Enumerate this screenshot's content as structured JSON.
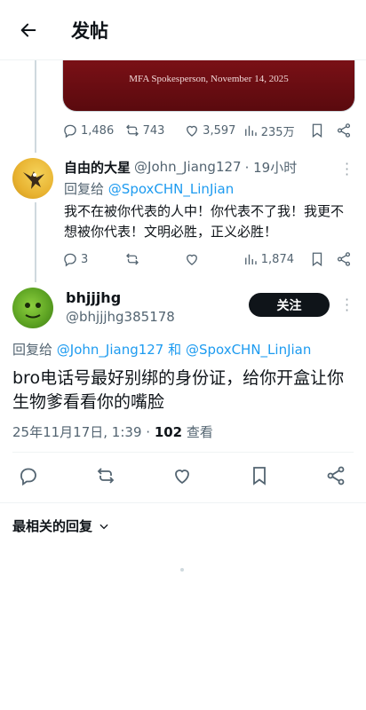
{
  "header": {
    "title": "发帖"
  },
  "quoted_post": {
    "caption": "MFA Spokesperson, November 14, 2025",
    "stats": {
      "replies": "1,486",
      "reposts": "743",
      "likes": "3,597",
      "views": "235万"
    }
  },
  "reply1": {
    "display_name": "自由的大星",
    "handle": "@John_Jiang127",
    "time": "· 19小时",
    "reply_prefix": "回复给",
    "reply_to": "@SpoxCHN_LinJian",
    "text": "我不在被你代表的人中！你代表不了我！我更不想被你代表！文明必胜，正义必胜！",
    "stats": {
      "replies": "3",
      "reposts": "",
      "likes": "",
      "views": "1,874"
    }
  },
  "main_post": {
    "display_name": "bhjjjhg",
    "handle": "@bhjjjhg385178",
    "follow_label": "关注",
    "reply_prefix": "回复给",
    "reply_to_1": "@John_Jiang127",
    "reply_conj": "和",
    "reply_to_2": "@SpoxCHN_LinJian",
    "text": "bro电话号最好别绑的身份证，给你开盒让你生物爹看看你的嘴脸",
    "timestamp": "25年11月17日, 1:39 ·",
    "view_count": "102",
    "view_label": "查看"
  },
  "replies_sort": {
    "label": "最相关的回复"
  }
}
